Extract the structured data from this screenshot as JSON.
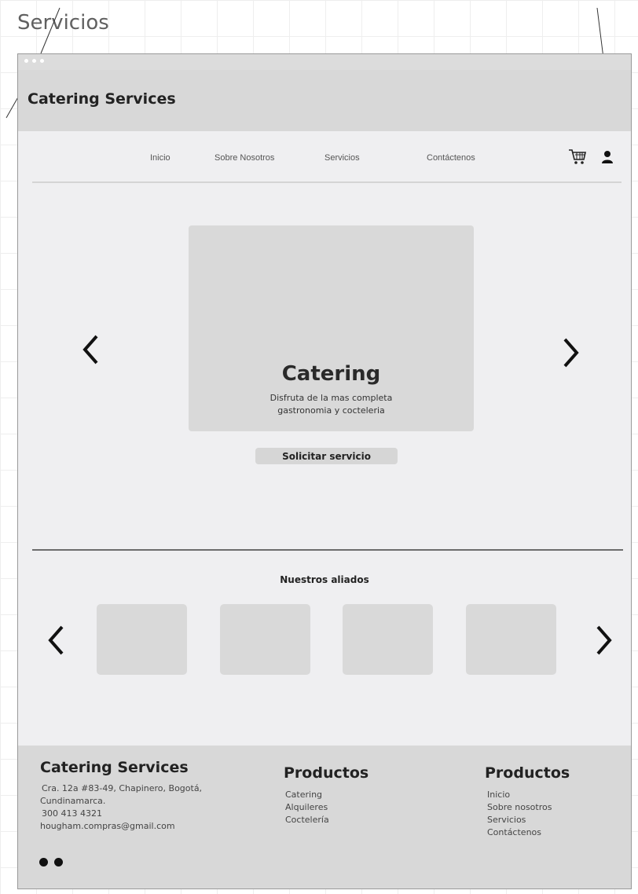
{
  "canvas": {
    "title": "Servicios"
  },
  "header": {
    "brand": "Catering Services"
  },
  "nav": {
    "items": [
      "Inicio",
      "Sobre Nosotros",
      "Servicios",
      "Contáctenos"
    ],
    "cart_icon": "shopping-cart-icon",
    "user_icon": "user-icon"
  },
  "hero": {
    "slide_title": "Catering",
    "slide_desc_line1": "Disfruta de la mas completa",
    "slide_desc_line2": "gastronomia y cocteleria",
    "prev_icon": "chevron-left-icon",
    "next_icon": "chevron-right-icon",
    "cta_label": "Solicitar servicio"
  },
  "allies": {
    "title": "Nuestros aliados",
    "prev_icon": "chevron-left-icon",
    "next_icon": "chevron-right-icon"
  },
  "footer": {
    "col1": {
      "title": "Catering Services",
      "address_line1": "Cra. 12a #83-49, Chapinero, Bogotá,",
      "address_line2": "Cundinamarca.",
      "phone": "300 413 4321",
      "email": "hougham.compras@gmail.com"
    },
    "col2": {
      "title": "Productos",
      "items": [
        "Catering",
        "Alquileres",
        "Coctelería"
      ]
    },
    "col3": {
      "title": "Productos",
      "items": [
        "Inicio",
        "Sobre nosotros",
        "Servicios",
        "Contáctenos"
      ]
    },
    "social_icons": [
      "instagram-icon",
      "facebook-icon"
    ]
  },
  "colors": {
    "header_bg": "#d8d8d8",
    "page_bg": "#efeff1",
    "placeholder": "#d9d9d9",
    "text": "#222222"
  }
}
